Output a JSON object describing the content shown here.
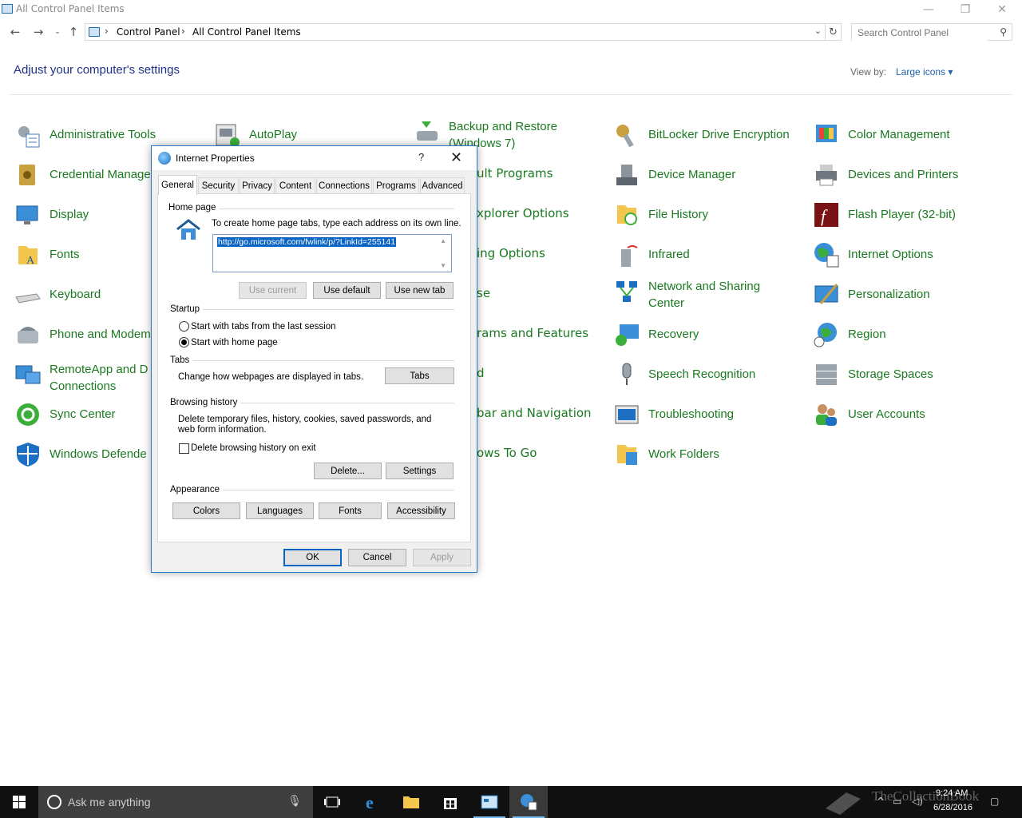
{
  "window": {
    "title": "All Control Panel Items",
    "minimize": "—",
    "restore": "❐",
    "close": "✕"
  },
  "address": {
    "crumbs": [
      "Control Panel",
      "All Control Panel Items"
    ],
    "search_placeholder": "Search Control Panel"
  },
  "heading": "Adjust your computer's settings",
  "view_by": {
    "label": "View by:",
    "value": "Large icons ▾"
  },
  "items": [
    [
      "Administrative Tools",
      "AutoPlay",
      "Backup and Restore (Windows 7)",
      "BitLocker Drive Encryption",
      "Color Management"
    ],
    [
      "Credential Manager",
      "Default Programs",
      "Device Manager",
      "Devices and Printers"
    ],
    [
      "Display",
      "Internet Explorer Options",
      "File History",
      "Flash Player (32-bit)"
    ],
    [
      "Fonts",
      "Indexing Options",
      "Infrared",
      "Internet Options"
    ],
    [
      "Keyboard",
      "Mouse",
      "Network and Sharing Center",
      "Personalization"
    ],
    [
      "Phone and Modem",
      "Programs and Features",
      "Recovery",
      "Region"
    ],
    [
      "RemoteApp and Desktop Connections",
      "Sound",
      "Speech Recognition",
      "Storage Spaces"
    ],
    [
      "Sync Center",
      "Taskbar and Navigation",
      "Troubleshooting",
      "User Accounts"
    ],
    [
      "Windows Defender",
      "Windows To Go",
      "Work Folders"
    ]
  ],
  "visible_labels": {
    "c0": [
      "Administrative Tools",
      "Credential Manage",
      "Display",
      "Fonts",
      "Keyboard",
      "Phone and Modem",
      "RemoteApp and D\nConnections",
      "Sync Center",
      "Windows Defende"
    ],
    "c1": [
      "AutoPlay"
    ],
    "c2": [
      "Backup and Restore\n(Windows 7)",
      "ult Programs",
      "xplorer Options",
      "ing Options",
      "se",
      "rams and Features",
      "d",
      "bar and Navigation",
      "ows To Go"
    ],
    "c3": [
      "BitLocker Drive Encryption",
      "Device Manager",
      "File History",
      "Infrared",
      "Network and Sharing\nCenter",
      "Recovery",
      "Speech Recognition",
      "Troubleshooting",
      "Work Folders"
    ],
    "c4": [
      "Color Management",
      "Devices and Printers",
      "Flash Player (32-bit)",
      "Internet Options",
      "Personalization",
      "Region",
      "Storage Spaces",
      "User Accounts"
    ]
  },
  "dialog": {
    "title": "Internet Properties",
    "help": "?",
    "close": "✕",
    "tabs": [
      "General",
      "Security",
      "Privacy",
      "Content",
      "Connections",
      "Programs",
      "Advanced"
    ],
    "home_page": {
      "label": "Home page",
      "hint": "To create home page tabs, type each address on its own line.",
      "url": "http://go.microsoft.com/fwlink/p/?LinkId=255141",
      "btn_current": "Use current",
      "btn_default": "Use default",
      "btn_newtab": "Use new tab"
    },
    "startup": {
      "label": "Startup",
      "opt1": "Start with tabs from the last session",
      "opt2": "Start with home page",
      "selected": 2
    },
    "tabs_group": {
      "label": "Tabs",
      "text": "Change how webpages are displayed in tabs.",
      "btn": "Tabs"
    },
    "history": {
      "label": "Browsing history",
      "text": "Delete temporary files, history, cookies, saved passwords, and web form information.",
      "checkbox": "Delete browsing history on exit",
      "checked": false,
      "btn_delete": "Delete...",
      "btn_settings": "Settings"
    },
    "appearance": {
      "label": "Appearance",
      "btn_colors": "Colors",
      "btn_languages": "Languages",
      "btn_fonts": "Fonts",
      "btn_accessibility": "Accessibility"
    },
    "footer": {
      "ok": "OK",
      "cancel": "Cancel",
      "apply": "Apply"
    }
  },
  "taskbar": {
    "search_placeholder": "Ask me anything",
    "time": "9:24 AM",
    "date": "6/28/2016",
    "watermark": "TheCollectionBook"
  },
  "colors": {
    "link_green": "#1a7a20",
    "heading_blue": "#1e3287",
    "accent": "#0a64c4",
    "taskbar": "#101010"
  }
}
